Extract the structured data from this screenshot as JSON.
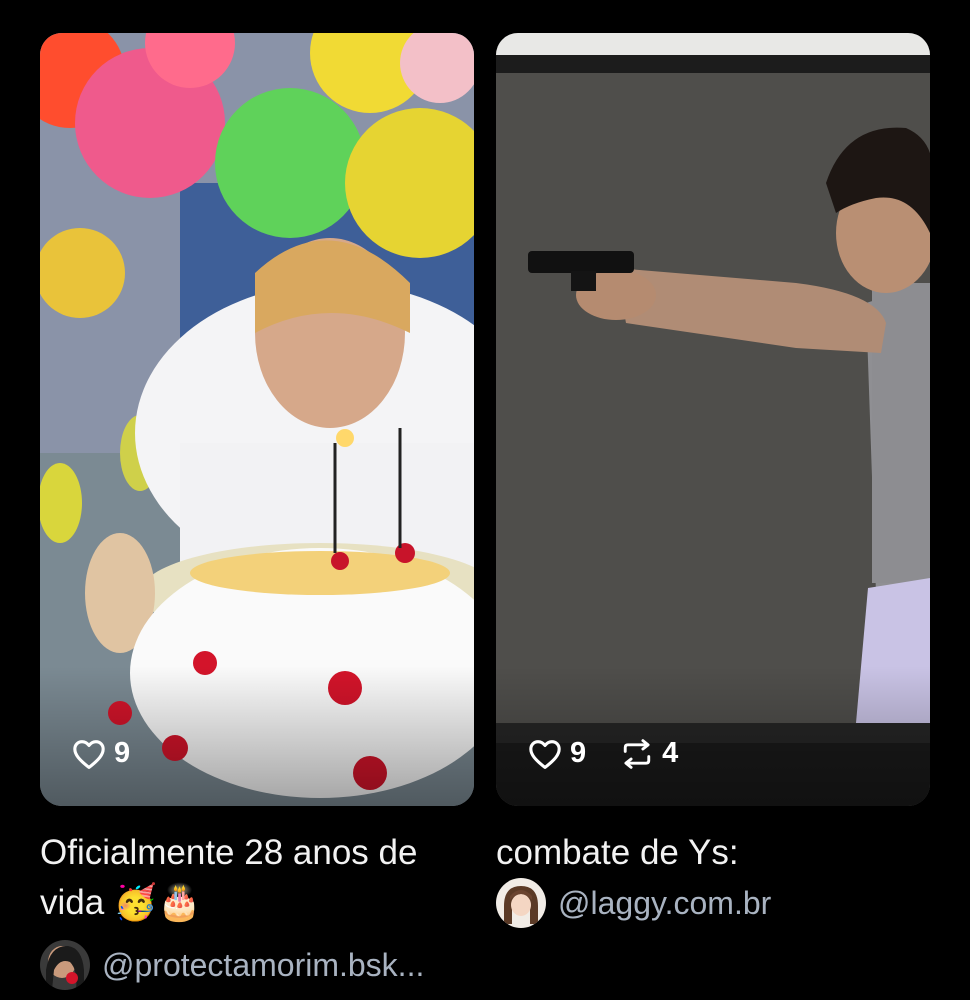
{
  "colors": {
    "background": "#000000",
    "caption_text": "#f2f2f2",
    "handle_text": "#a9b3c1",
    "stat_text": "#ffffff"
  },
  "posts": [
    {
      "thumbnail": "birthday-cake-photo",
      "likes": "9",
      "caption": "Oficialmente 28 anos de vida 🥳🎂",
      "handle": "@protectamorim.bsk..."
    },
    {
      "thumbnail": "man-pointing-pistol-photo",
      "likes": "9",
      "reposts": "4",
      "caption": "combate de Ys:",
      "handle": "@laggy.com.br"
    }
  ],
  "icons": {
    "like": "heart-icon",
    "repost": "repost-icon"
  }
}
